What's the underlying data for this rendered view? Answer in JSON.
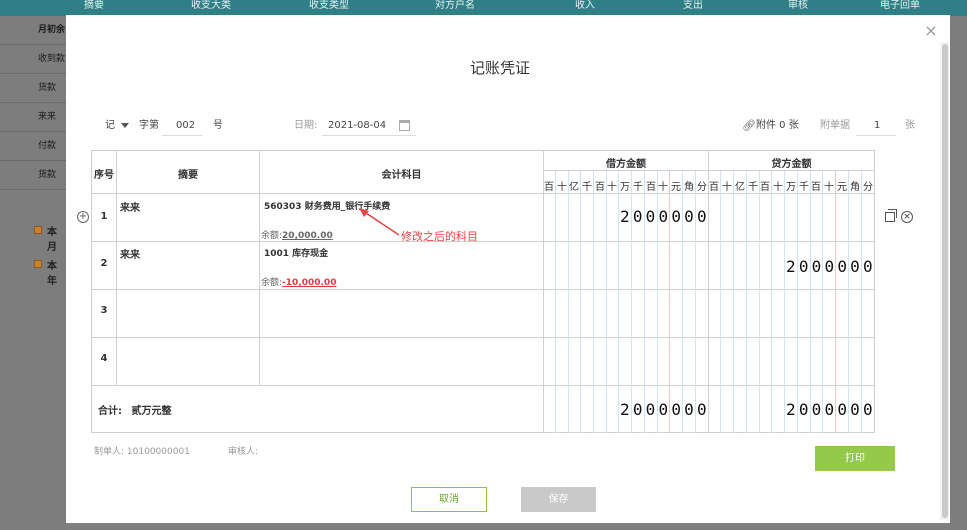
{
  "background": {
    "header_columns": [
      "摘要",
      "收支大类",
      "收支类型",
      "对方户名",
      "收入",
      "支出",
      "审核",
      "电子回单"
    ],
    "left_rows": [
      "月初余",
      "收到款",
      "货款",
      "来来",
      "付款",
      "货款"
    ],
    "section_labels": [
      "本月",
      "本年"
    ]
  },
  "modal": {
    "title": "记账凭证",
    "close_glyph": "×",
    "voucher_word": "记",
    "word_label": "字第",
    "number": "002",
    "number_suffix": "号",
    "date_label": "日期:",
    "date_value": "2021-08-04",
    "attachment_label": "附件 0 张",
    "receipt_label": "附单据",
    "receipt_count": "1",
    "receipt_unit": "张",
    "headers": {
      "index": "序号",
      "summary": "摘要",
      "account": "会计科目",
      "debit": "借方金额",
      "credit": "贷方金额"
    },
    "digit_units": [
      "百",
      "十",
      "亿",
      "千",
      "百",
      "十",
      "万",
      "千",
      "百",
      "十",
      "元",
      "角",
      "分"
    ],
    "rows": [
      {
        "index": "1",
        "summary": "来来",
        "account": "560303 财务费用_银行手续费",
        "balance_label": "余额:",
        "balance": "20,000.00",
        "debit": "2000000",
        "credit": ""
      },
      {
        "index": "2",
        "summary": "来来",
        "account": "1001 库存现金",
        "balance_label": "余额:",
        "balance": "-10,000.00",
        "debit": "",
        "credit": "2000000"
      },
      {
        "index": "3",
        "summary": "",
        "account": "",
        "debit": "",
        "credit": ""
      },
      {
        "index": "4",
        "summary": "",
        "account": "",
        "debit": "",
        "credit": ""
      }
    ],
    "total_label": "合计:",
    "total_words": "贰万元整",
    "total_debit": "2000000",
    "total_credit": "2000000",
    "annotation": "修改之后的科目",
    "preparer_label": "制单人:",
    "preparer": "10100000001",
    "reviewer_label": "审核人:",
    "print_label": "打印",
    "cancel_label": "取消",
    "save_label": "保存"
  },
  "colors": {
    "brand_green": "#95c94a",
    "annotation_red": "#e64545",
    "header_teal": "#2f7f86"
  }
}
